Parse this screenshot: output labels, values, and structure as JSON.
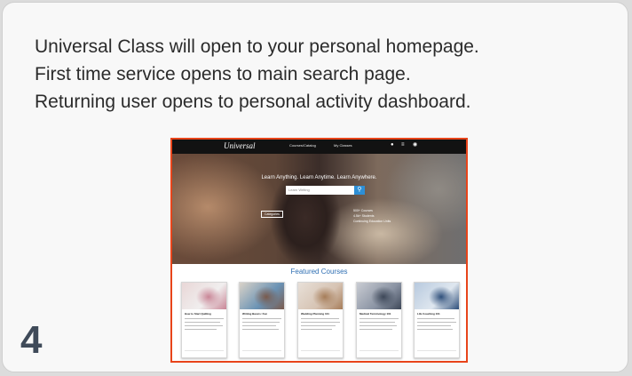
{
  "card": {
    "description_lines": [
      "Universal Class will open to  your personal homepage.",
      "First time service opens to main search page.",
      "Returning user opens to personal activity dashboard."
    ],
    "step_number": "4"
  },
  "screenshot": {
    "nav": {
      "logo": "Universal",
      "links": [
        "Courses/Catalog",
        "My Classes"
      ],
      "icons": [
        "user-icon",
        "list-icon",
        "settings-icon"
      ]
    },
    "hero": {
      "tagline": "Learn Anything. Learn Anytime. Learn Anywhere.",
      "search_placeholder": "Learn Writing",
      "categories_button": "Categories",
      "stats": [
        "500+ Courses",
        "4.5k+ Students",
        "Continuing Education Units"
      ]
    },
    "featured_title": "Featured Courses",
    "courses": [
      {
        "title": "How to Start Quilting",
        "img_colors": [
          "#e9d7d7",
          "#c98596",
          "#f0eeee"
        ]
      },
      {
        "title": "Writing Basics: Fun",
        "img_colors": [
          "#d9d2c8",
          "#7a5a4c",
          "#6a92b4"
        ]
      },
      {
        "title": "Wedding Planning 101",
        "img_colors": [
          "#e8e0d8",
          "#a67d59",
          "#d6c3b3"
        ]
      },
      {
        "title": "Medical Terminology 101",
        "img_colors": [
          "#c9ccd3",
          "#3d4758",
          "#8a93a3"
        ]
      },
      {
        "title": "Life Coaching 101",
        "img_colors": [
          "#b7c9de",
          "#2d4e7a",
          "#dfe7ef"
        ]
      }
    ],
    "frame_color": "#e8441a",
    "accent_color": "#2d8fd6"
  }
}
